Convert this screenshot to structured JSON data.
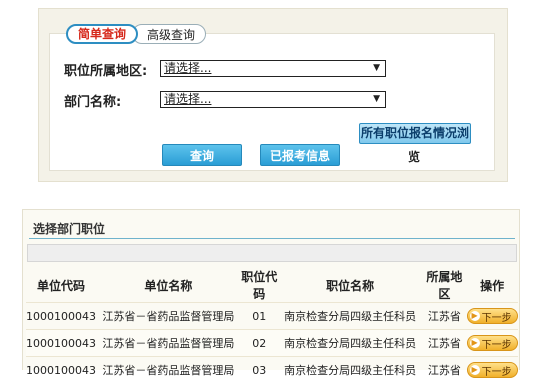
{
  "tabs": {
    "simple": "简单查询",
    "advanced": "高级查询"
  },
  "form": {
    "region_label": "职位所属地区:",
    "region_value": "请选择...",
    "dept_label": "部门名称:",
    "dept_value": "请选择..."
  },
  "buttons": {
    "query": "查询",
    "reported": "已报考信息",
    "all_status": "所有职位报名情况浏",
    "all_status_tail": "览"
  },
  "dept_section": {
    "title": "选择部门职位",
    "columns": [
      "单位代码",
      "单位名称",
      "职位代码",
      "职位名称",
      "所属地区",
      "操作"
    ],
    "rows": [
      {
        "unit_code": "1000100043",
        "unit_name": "江苏省－省药品监督管理局",
        "pos_code": "01",
        "pos_name": "南京检查分局四级主任科员",
        "region": "江苏省",
        "action": "下一步"
      },
      {
        "unit_code": "1000100043",
        "unit_name": "江苏省－省药品监督管理局",
        "pos_code": "02",
        "pos_name": "南京检查分局四级主任科员",
        "region": "江苏省",
        "action": "下一步"
      },
      {
        "unit_code": "1000100043",
        "unit_name": "江苏省－省药品监督管理局",
        "pos_code": "03",
        "pos_name": "南京检查分局四级主任科员",
        "region": "江苏省",
        "action": "下一步"
      }
    ]
  },
  "icons": {
    "dropdown": "chevron-down-icon",
    "next": "arrow-right-circle-icon"
  },
  "colors": {
    "accent": "#2a9dd5",
    "active_tab_text": "#d6281b",
    "next_button": "#f1b02b"
  }
}
